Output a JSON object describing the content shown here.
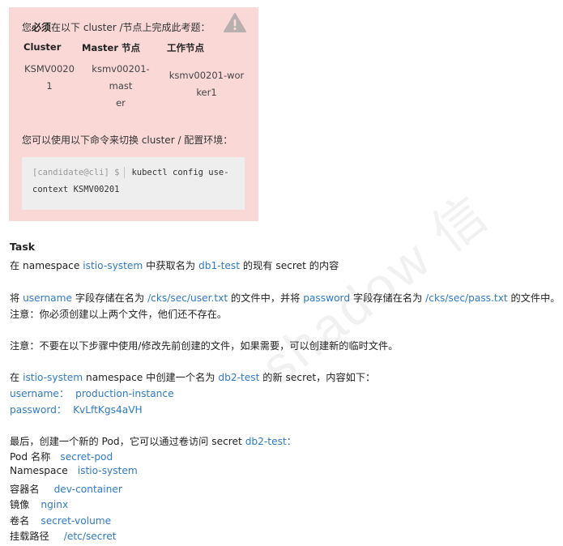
{
  "panel": {
    "intro_prefix": "您",
    "intro_bold": "必须",
    "intro_suffix": "在以下 cluster /节点上完成此考题：",
    "warning_icon": "warning-triangle-icon",
    "headers": [
      "Cluster",
      "Master 节点",
      "工作节点"
    ],
    "cluster": [
      "KSMV0020",
      "1"
    ],
    "master": [
      "ksmv00201-mast",
      "er"
    ],
    "worker": [
      "ksmv00201-wor",
      "ker1"
    ],
    "switch_text": "您可以使用以下命令来切换 cluster / 配置环境：",
    "prompt": "[candidate@cli] $",
    "command_1": "kubectl config use-",
    "command_2": "context KSMV00201"
  },
  "watermark": "shadow 信",
  "task": {
    "title": "Task",
    "l1": [
      "在 namespace ",
      "istio-system",
      " 中获取名为 ",
      "db1-test",
      " 的现有 secret 的内容"
    ],
    "l2": [
      "将 ",
      "username",
      " 字段存储在名为 ",
      "/cks/sec/user.txt",
      " 的文件中，并将 ",
      "password",
      " 字段存储在名为 ",
      "/cks/sec/pass.txt",
      " 的文件中。"
    ],
    "l3": "注意：你必须创建以上两个文件，他们还不存在。",
    "l4": "注意：不要在以下步骤中使用/修改先前创建的文件，如果需要，可以创建新的临时文件。",
    "l5": [
      "在 ",
      "istio-system",
      " namespace 中创建一个名为 ",
      "db2-test",
      " 的新 secret，内容如下："
    ],
    "l6": [
      "username",
      "：",
      "production-instance"
    ],
    "l7": [
      "password",
      "：",
      "KvLftKgs4aVH"
    ],
    "l8": [
      "最后，创建一个新的 Pod，它可以通过卷访问 secret ",
      "db2-test",
      "："
    ],
    "l9": [
      "Pod 名称",
      "secret-pod"
    ],
    "l10": [
      "Namespace",
      "istio-system"
    ],
    "l11": [
      "容器名",
      "dev-container"
    ],
    "l12": [
      "镜像",
      "nginx"
    ],
    "l13": [
      "卷名",
      "secret-volume"
    ],
    "l14": [
      "挂载路径",
      "/etc/secret"
    ]
  }
}
